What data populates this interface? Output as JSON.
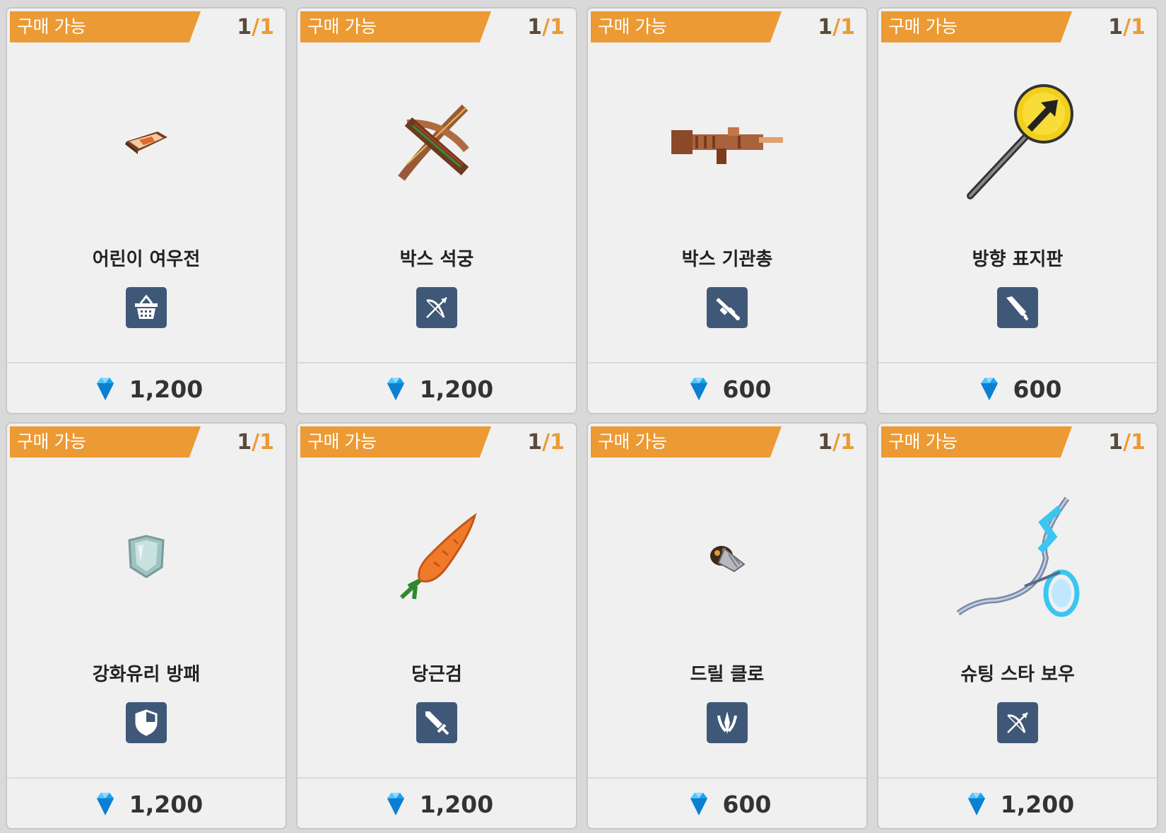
{
  "cards": [
    {
      "status": "구매 가능",
      "owned": "1",
      "total": "1",
      "name": "어린이 여우전",
      "price": "1,200",
      "icon": "basket-icon",
      "art": "fox-book-icon"
    },
    {
      "status": "구매 가능",
      "owned": "1",
      "total": "1",
      "name": "박스 석궁",
      "price": "1,200",
      "icon": "bow-icon",
      "art": "crossbow-icon"
    },
    {
      "status": "구매 가능",
      "owned": "1",
      "total": "1",
      "name": "박스 기관총",
      "price": "600",
      "icon": "gun-icon",
      "art": "machine-gun-icon"
    },
    {
      "status": "구매 가능",
      "owned": "1",
      "total": "1",
      "name": "방향 표지판",
      "price": "600",
      "icon": "blade-icon",
      "art": "direction-sign-icon"
    },
    {
      "status": "구매 가능",
      "owned": "1",
      "total": "1",
      "name": "강화유리 방패",
      "price": "1,200",
      "icon": "shield-icon",
      "art": "glass-shield-icon"
    },
    {
      "status": "구매 가능",
      "owned": "1",
      "total": "1",
      "name": "당근검",
      "price": "1,200",
      "icon": "sword-icon",
      "art": "carrot-sword-icon"
    },
    {
      "status": "구매 가능",
      "owned": "1",
      "total": "1",
      "name": "드릴 클로",
      "price": "600",
      "icon": "claw-icon",
      "art": "drill-claw-icon"
    },
    {
      "status": "구매 가능",
      "owned": "1",
      "total": "1",
      "name": "슈팅 스타 보우",
      "price": "1,200",
      "icon": "bow-icon",
      "art": "shooting-star-bow-icon"
    }
  ],
  "colors": {
    "ribbon": "#ec9a34",
    "type_badge": "#3f5877",
    "gem": "#1aa3f0"
  },
  "currency_icon": "gem-icon"
}
